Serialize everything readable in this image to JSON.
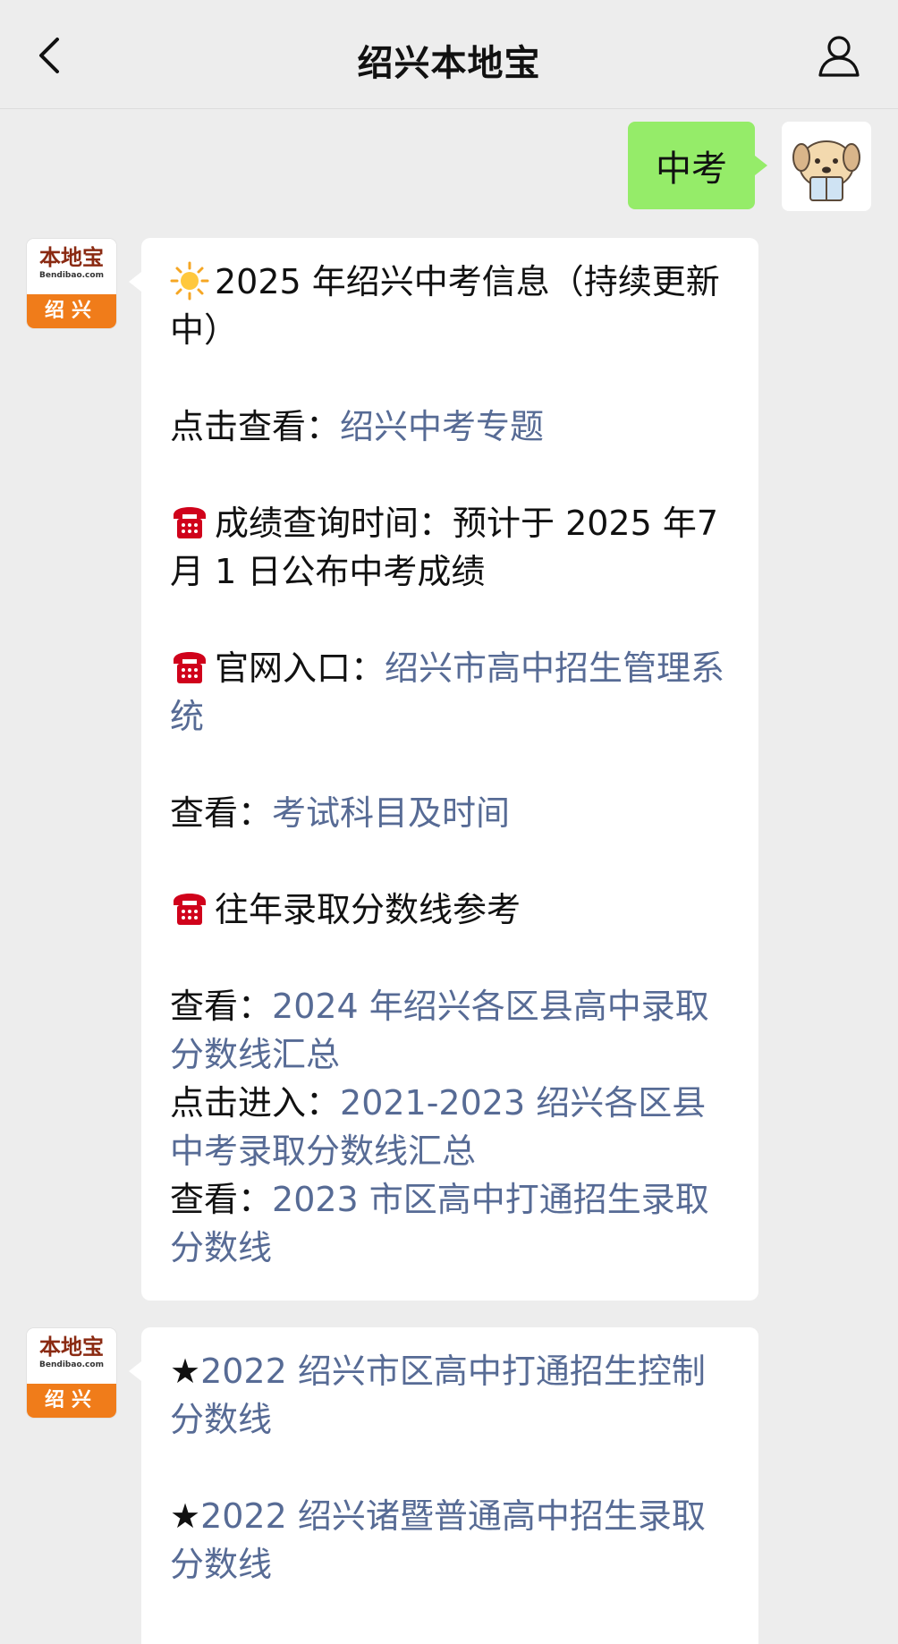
{
  "header": {
    "title": "绍兴本地宝"
  },
  "sent": {
    "text": "中考"
  },
  "bot_avatar": {
    "brand": "本地宝",
    "domain": "Bendibao.com",
    "city": "绍兴"
  },
  "message1": {
    "headline": "2025 年绍兴中考信息（持续更新中）",
    "click_view_label": "点击查看：",
    "click_view_link": "绍兴中考专题",
    "score_query": "成绩查询时间：预计于 2025 年7 月 1 日公布中考成绩",
    "official_label": "官网入口：",
    "official_link": "绍兴市高中招生管理系统",
    "view_label1": "查看：",
    "view_link1": "考试科目及时间",
    "past_scores": "往年录取分数线参考",
    "view_label2": "查看：",
    "view_link2": "2024 年绍兴各区县高中录取分数线汇总",
    "enter_label": "点击进入：",
    "enter_link": "2021-2023 绍兴各区县中考录取分数线汇总",
    "view_label3": "查看：",
    "view_link3": "2023 市区高中打通招生录取分数线"
  },
  "message2": {
    "star": "★",
    "link1": "2022 绍兴市区高中打通招生控制分数线",
    "link2": "2022 绍兴诸暨普通高中招生录取分数线"
  },
  "icons": {
    "sun": "sun-icon",
    "phone": "telephone-icon"
  },
  "colors": {
    "link": "#576b95",
    "sent_bubble": "#95ec69",
    "background": "#ededed",
    "brand_orange": "#f07c1a"
  }
}
